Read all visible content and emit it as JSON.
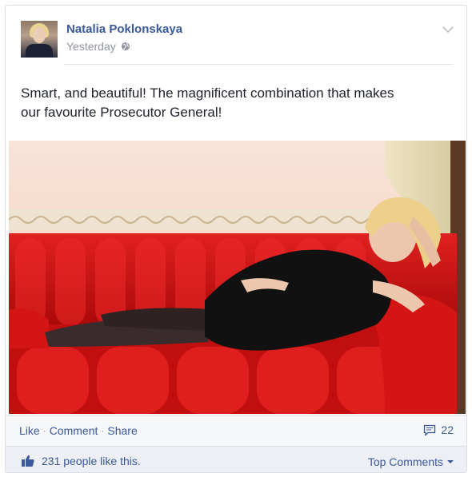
{
  "post": {
    "author": "Natalia Poklonskaya",
    "timestamp": "Yesterday",
    "privacy_icon": "globe-icon",
    "text_line1": "Smart, and beautiful! The magnificent combination that makes",
    "text_line2": "our favourite Prosecutor General!"
  },
  "actions": {
    "like": "Like",
    "sep": "·",
    "comment": "Comment",
    "share": "Share",
    "comment_count": "22"
  },
  "summary": {
    "likes_text": "231 people like this.",
    "top_comments": "Top Comments"
  },
  "colors": {
    "link_blue": "#3b5998",
    "sofa_red": "#d41515",
    "wall": "#f4d6c7"
  }
}
